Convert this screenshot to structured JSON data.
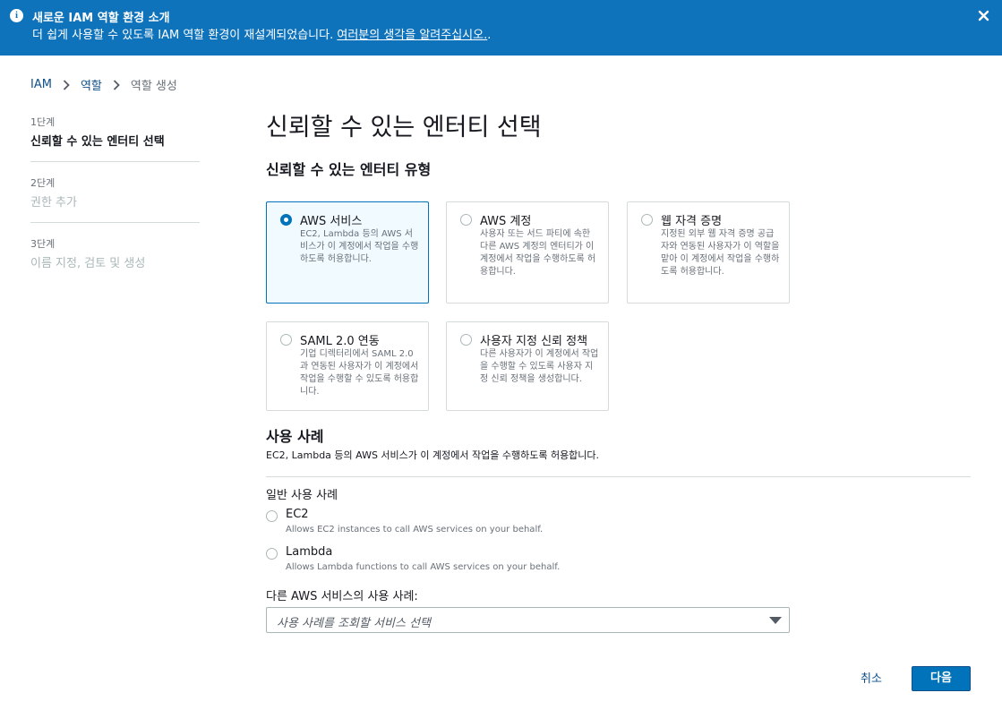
{
  "banner": {
    "title": "새로운 IAM 역할 환경 소개",
    "text": "더 쉽게 사용할 수 있도록 IAM 역할 환경이 재설계되었습니다. ",
    "link": "여러분의 생각을 알려주십시오.",
    "suffix": "."
  },
  "breadcrumb": [
    "IAM",
    "역할",
    "역할 생성"
  ],
  "steps": [
    {
      "num": "1단계",
      "label": "신뢰할 수 있는 엔터티 선택"
    },
    {
      "num": "2단계",
      "label": "권한 추가"
    },
    {
      "num": "3단계",
      "label": "이름 지정, 검토 및 생성"
    }
  ],
  "page_title": "신뢰할 수 있는 엔터티 선택",
  "section_title": "신뢰할 수 있는 엔터티 유형",
  "entity_types": [
    {
      "title": "AWS 서비스",
      "desc": "EC2, Lambda 등의 AWS 서비스가 이 계정에서 작업을 수행하도록 허용합니다.",
      "selected": true
    },
    {
      "title": "AWS 계정",
      "desc": "사용자 또는 서드 파티에 속한 다른 AWS 계정의 엔터티가 이 계정에서 작업을 수행하도록 허용합니다.",
      "selected": false
    },
    {
      "title": "웹 자격 증명",
      "desc": "지정된 외부 웹 자격 증명 공급자와 연동된 사용자가 이 역할을 맡아 이 계정에서 작업을 수행하도록 허용합니다.",
      "selected": false
    },
    {
      "title": "SAML 2.0 연동",
      "desc": "기업 디렉터리에서 SAML 2.0과 연동된 사용자가 이 계정에서 작업을 수행할 수 있도록 허용합니다.",
      "selected": false
    },
    {
      "title": "사용자 지정 신뢰 정책",
      "desc": "다른 사용자가 이 계정에서 작업을 수행할 수 있도록 사용자 지정 신뢰 정책을 생성합니다.",
      "selected": false
    }
  ],
  "use_case": {
    "title": "사용 사례",
    "desc": "EC2, Lambda 등의 AWS 서비스가 이 계정에서 작업을 수행하도록 허용합니다.",
    "common_label": "일반 사용 사례",
    "options": [
      {
        "title": "EC2",
        "desc": "Allows EC2 instances to call AWS services on your behalf."
      },
      {
        "title": "Lambda",
        "desc": "Allows Lambda functions to call AWS services on your behalf."
      }
    ],
    "other_label": "다른 AWS 서비스의 사용 사례:",
    "select_placeholder": "사용 사례를 조회할 서비스 선택"
  },
  "actions": {
    "cancel": "취소",
    "next": "다음"
  },
  "colors": {
    "banner": "#0f73bb",
    "primary": "#0073bb",
    "selected_bg": "#f1faff"
  }
}
